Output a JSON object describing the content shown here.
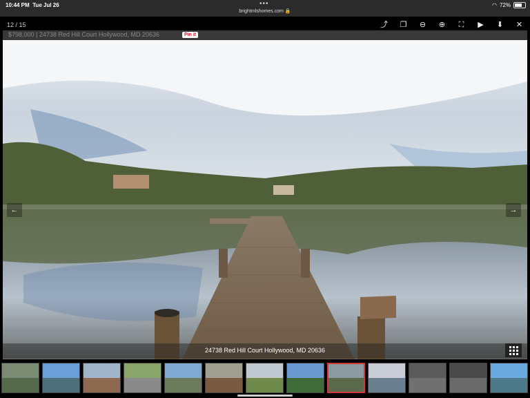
{
  "statusbar": {
    "time": "10:44 PM",
    "date": "Tue Jul 26",
    "dots": "•••",
    "url": "brightmlshomes.com",
    "battery": "72%",
    "battery_level": 0.72,
    "wifi_icon": "wifi-icon",
    "lock_icon": "lock-icon"
  },
  "viewer": {
    "counter": "12 / 15",
    "tools": [
      {
        "name": "share-icon",
        "glyph": "⤴"
      },
      {
        "name": "copy-icon",
        "glyph": "❐"
      },
      {
        "name": "zoom-out-icon",
        "glyph": "⊖"
      },
      {
        "name": "zoom-in-icon",
        "glyph": "⊕"
      },
      {
        "name": "fullscreen-icon",
        "glyph": "⛶"
      },
      {
        "name": "play-icon",
        "glyph": "▶"
      },
      {
        "name": "download-icon",
        "glyph": "⬇"
      },
      {
        "name": "close-icon",
        "glyph": "✕"
      }
    ],
    "caption": "$798,000 | 24738 Red Hill Court Hollywood, MD 20636",
    "pin_label": "Pin it",
    "prev_glyph": "←",
    "next_glyph": "→",
    "photo_caption": "24738 Red Hill Court Hollywood, MD 20636",
    "grid_icon": "grid-icon"
  },
  "thumbnails": [
    {
      "sky": "#7b8a73",
      "ground": "#556a4b"
    },
    {
      "sky": "#6aa0d8",
      "ground": "#4d6f7a"
    },
    {
      "sky": "#9fb3c9",
      "ground": "#8d6a4f"
    },
    {
      "sky": "#8aa56b",
      "ground": "#8a8a8a"
    },
    {
      "sky": "#7fa8d2",
      "ground": "#6b7a5a"
    },
    {
      "sky": "#a0a090",
      "ground": "#7a5a40"
    },
    {
      "sky": "#c0c8d0",
      "ground": "#6f8a4a"
    },
    {
      "sky": "#6a98d0",
      "ground": "#3f6a3a"
    },
    {
      "sky": "#8a9aa0",
      "ground": "#5a6a4a"
    },
    {
      "sky": "#c8ccd4",
      "ground": "#6a7f90"
    },
    {
      "sky": "#5a5a5a",
      "ground": "#707070"
    },
    {
      "sky": "#4a4a4a",
      "ground": "#6a6a6a"
    },
    {
      "sky": "#6aa8e0",
      "ground": "#4d7a8a"
    }
  ],
  "active_thumbnail": 8,
  "colors": {
    "active_border": "#d23a3a",
    "pin": "#c8232c"
  }
}
